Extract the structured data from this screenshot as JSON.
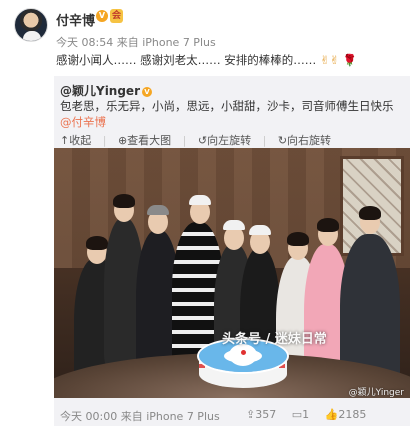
{
  "post": {
    "username": "付辛博",
    "verified_badge": "V",
    "level_badge": "会",
    "meta": "今天 08:54 来自 iPhone 7 Plus",
    "text": "感谢小闻人…… 感谢刘老太…… 安排的棒棒的……",
    "emoji_hands": "✌✌",
    "emoji_rose": "🌹"
  },
  "repost": {
    "author": "@颖儿Yinger",
    "verified_badge": "V",
    "text": "包老思，乐无异，小尚，思远，小甜甜，沙卡，司音师傅生日快乐",
    "mention": "@付辛博",
    "tools": {
      "collapse": "收起",
      "view_large": "查看大图",
      "rotate_left": "向左旋转",
      "rotate_right": "向右旋转"
    },
    "photo_watermark": "@颖儿Yinger",
    "meta": "今天 00:00 来自 iPhone 7 Plus",
    "stats": {
      "reposts": "357",
      "comments": "1",
      "likes": "2185"
    }
  },
  "overlay_watermark": "头条号 / 迷妹日常",
  "colors": {
    "link": "#eb7350",
    "quote_bg": "#f2f2f5",
    "meta": "#888888"
  }
}
